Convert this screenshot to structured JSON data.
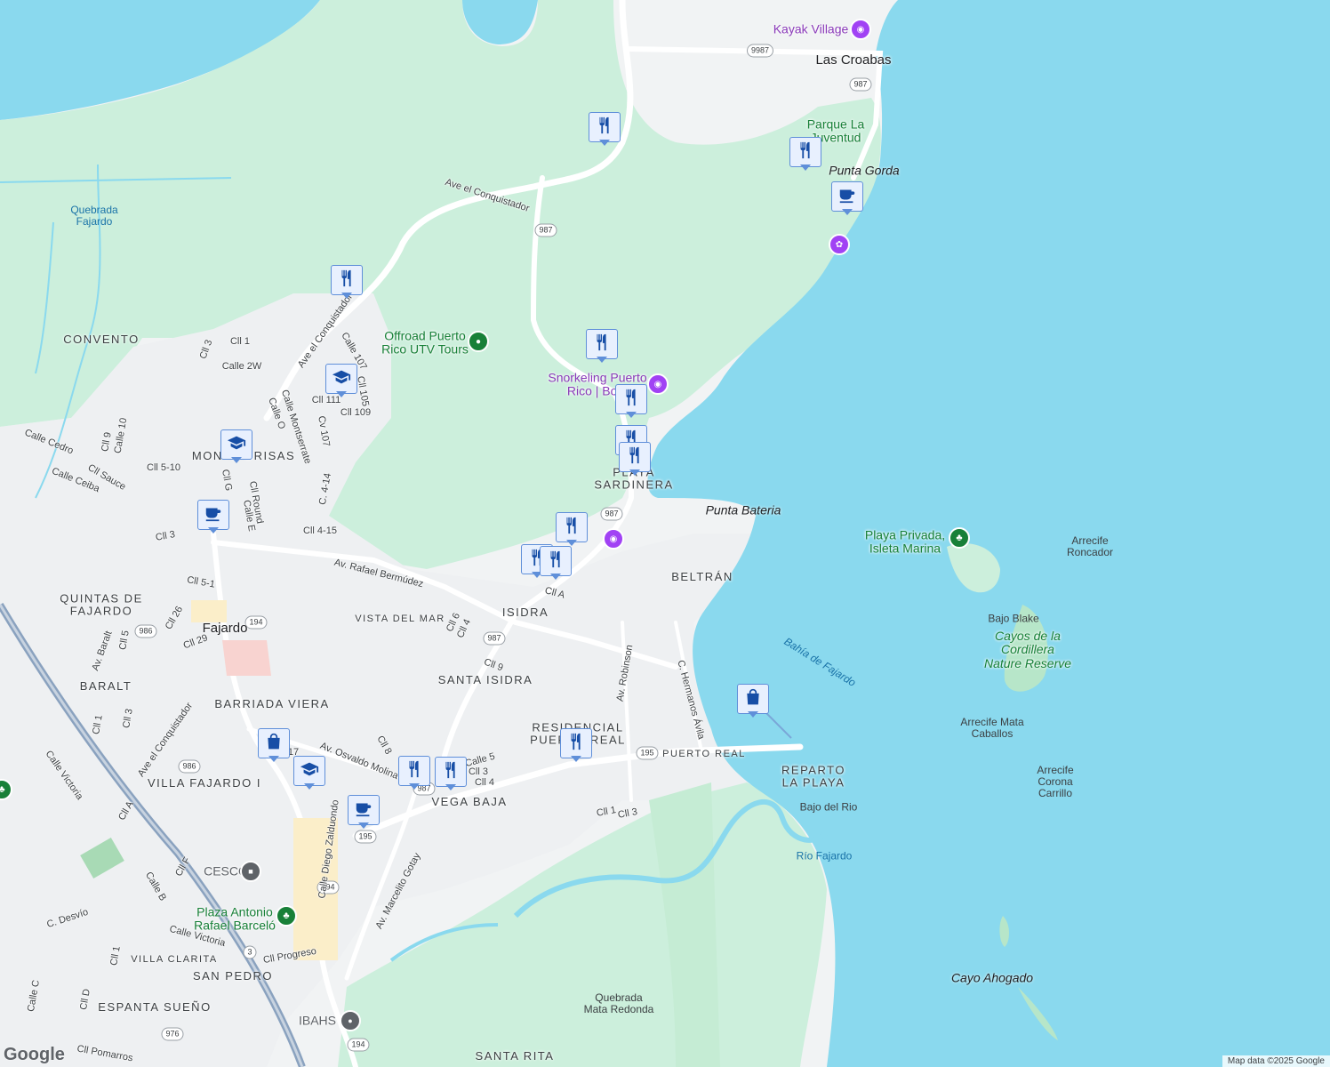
{
  "map": {
    "attribution": "Map data ©2025 Google",
    "logo": "Google",
    "colors": {
      "water": "#8ad9ee",
      "land": "#f1f3f4",
      "green": "#ccefdc",
      "road": "#ffffff",
      "highway": "#8aa2bf",
      "pin_fill": "#e8f0fe",
      "pin_border": "#5f8fd9",
      "icon": "#174ea6"
    }
  },
  "labels": {
    "las_croabas": "Las Croabas",
    "kayak_village": "Kayak Village",
    "parque_la_juventud": "Parque La\nJuventud",
    "punta_gorda": "Punta Gorda",
    "quebrada_fajardo": "Quebrada\nFajardo",
    "ave_conquistador_n": "Ave el Conquistador",
    "offroad": "Offroad Puerto\nRico UTV Tours",
    "snorkeling": "Snorkeling Puerto\nRico | Boat",
    "convento": "CONVENTO",
    "monte_brisas": "MONTE BRISAS",
    "playa_sardinera": "PLAYA\nSARDINERA",
    "punta_bateria": "Punta Bateria",
    "playa_privada": "Playa Privada,\nIsleta Marina",
    "arrecife_roncador": "Arrecife\nRoncador",
    "beltran": "BELTRÁN",
    "bajo_blake": "Bajo Blake",
    "cayos_cordillera": "Cayos de la\nCordillera\nNature Reserve",
    "bahia_fajardo": "Bahía de Fajardo",
    "arrecife_mata": "Arrecife Mata\nCaballos",
    "arrecife_corona": "Arrecife\nCorona\nCarrillo",
    "quintas_fajardo": "QUINTAS DE\nFAJARDO",
    "fajardo": "Fajardo",
    "isidra": "ISIDRA",
    "vista_del_mar": "VISTA DEL MAR",
    "santa_isidra": "SANTA ISIDRA",
    "baralt": "BARALT",
    "barriada_viera": "BARRIADA VIERA",
    "villa_fajardo": "VILLA FAJARDO I",
    "vega_baja": "VEGA BAJA",
    "residencial": "RESIDENCIAL\nPUERTO REAL",
    "puerto_real": "PUERTO REAL",
    "reparto_playa": "REPARTO\nLA PLAYA",
    "bajo_rio": "Bajo del Rio",
    "rio_fajardo": "Río Fajardo",
    "cesco": "CESCO",
    "plaza": "Plaza Antonio\nRafael Barceló",
    "villa_clarita": "VILLA CLARITA",
    "san_pedro": "SAN PEDRO",
    "espanta_sueno": "ESPANTA SUEÑO",
    "quebrada_mata": "Quebrada\nMata Redonda",
    "ibahs": "IBAHS",
    "santa_rita": "SANTA RITA",
    "cayo_ahogado": "Cayo Ahogado"
  },
  "streets": {
    "av_rafael": "Av. Rafael Bermúdez",
    "cll_1": "Cll 1",
    "calle_2w": "Calle 2W",
    "cll_3": "Cll 3",
    "cll_107": "Calle 107",
    "cll_105": "Cll 105",
    "cll_111": "Cll 111",
    "cll_109": "Cll 109",
    "cv_107": "Cv 107",
    "ave_conq_mb": "Ave el Conquistador",
    "calle_montserrate": "Calle Montserrate",
    "calle_o": "Calle O",
    "calle_cedro": "Calle Cedro",
    "calle_ceiba": "Calle Ceiba",
    "cll_sauce": "Cll Sauce",
    "cll_5_10": "Cll 5-10",
    "cll_9": "Cll 9",
    "calle_10": "Calle 10",
    "c_4_14": "C. 4-14",
    "cll_4_15": "Cll 4-15",
    "cll_round": "Cll Round",
    "calle_e": "Calle E",
    "cll_g": "Cll G",
    "cll_5_1": "Cll 5-1",
    "cll_a": "Cll A",
    "cll_6": "Cll 6",
    "cll_4": "Cll 4",
    "cll_9b": "Cll 9",
    "av_robinson": "Av. Robinson",
    "c_hermanos": "C. Hermanos Ávila",
    "cll_26": "Cll 26",
    "cll_29": "Cll 29",
    "av_baralt": "Av. Baralt",
    "cll_5": "Cll 5",
    "ave_conq_s": "Ave el Conquistador",
    "calle_victoria": "Calle Victoria",
    "av_osvaldo": "Av. Osvaldo Molina",
    "calle_5b": "Calle 5",
    "cll_3b": "Cll 3",
    "cll_4b": "Cll 4",
    "cll_8": "Cll 8",
    "cll_17": "Cll 17",
    "cll_1b": "Cll 1",
    "cll_3c": "Cll 3",
    "av_marcelito": "Av. Marcelito Gotay",
    "calle_diego": "Calle Diego Zalduondo",
    "cll_f": "Cll F",
    "calle_b": "Calle B",
    "c_desvio": "C. Desvío",
    "calle_victoria_s": "Calle Victoria",
    "cll_progreso": "Cll Progreso",
    "cll_pomarros": "Cll Pomarros",
    "calle_c": "Calle C",
    "cll_d": "Cll D",
    "cll_a_sw": "Cll A",
    "cll_1c": "Cll 1",
    "cll_3d": "Cll 3"
  },
  "shields": [
    "9987",
    "987",
    "987",
    "987",
    "987",
    "986",
    "194",
    "195",
    "195",
    "194",
    "3",
    "976",
    "194",
    "986"
  ],
  "pins": [
    "restaurant",
    "restaurant",
    "restaurant",
    "restaurant",
    "restaurant",
    "restaurant",
    "restaurant",
    "restaurant",
    "restaurant",
    "restaurant",
    "restaurant",
    "restaurant",
    "restaurant",
    "coffee",
    "coffee",
    "coffee",
    "school",
    "school",
    "school",
    "shopping",
    "shopping"
  ]
}
